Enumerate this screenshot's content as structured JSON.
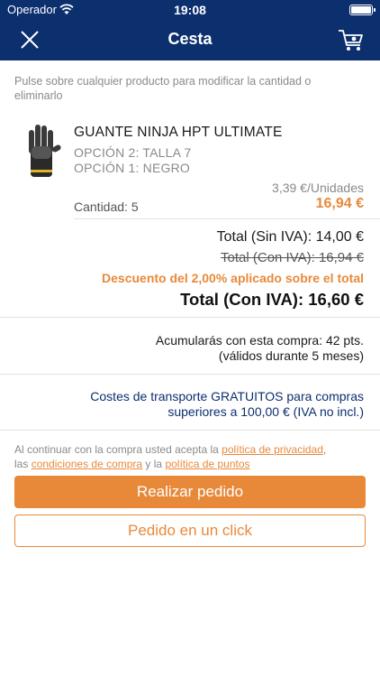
{
  "status_bar": {
    "carrier": "Operador",
    "time": "19:08"
  },
  "nav": {
    "title": "Cesta",
    "close_icon": "close-icon",
    "cart_icon": "cart-icon"
  },
  "hint": "Pulse sobre cualquier producto para modificar la cantidad o eliminarlo",
  "product": {
    "name": "GUANTE NINJA HPT ULTIMATE",
    "option2": "OPCIÓN 2: TALLA 7",
    "option1": "OPCIÓN 1: NEGRO",
    "unit_price": "3,39 €/Unidades",
    "line_total": "16,94 €",
    "quantity": "Cantidad: 5"
  },
  "totals": {
    "sin_iva": "Total (Sin IVA): 14,00 €",
    "con_iva_old": "Total (Con IVA): 16,94 €",
    "discount": "Descuento del 2,00% aplicado sobre el total",
    "con_iva": "Total (Con IVA): 16,60 €"
  },
  "points": {
    "line1": "Acumularás con esta compra: 42 pts.",
    "line2": "(válidos durante 5 meses)"
  },
  "shipping": {
    "line1": "Costes de transporte GRATUITOS para compras",
    "line2": "superiores a 100,00 € (IVA no incl.)"
  },
  "terms": {
    "prefix": "Al continuar con la compra usted acepta la ",
    "privacy_link": "política de privacidad",
    "sep1": ",",
    "prefix2": "las ",
    "conditions_link": "condiciones de compra",
    "and": " y la ",
    "points_link": "política de puntos"
  },
  "buttons": {
    "order": "Realizar pedido",
    "one_click": "Pedido en un click"
  },
  "colors": {
    "navy": "#0c2f6e",
    "accent": "#e8893a"
  }
}
